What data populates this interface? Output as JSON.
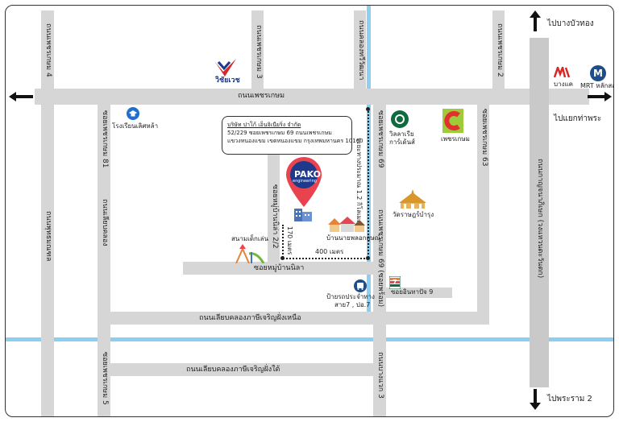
{
  "roads": {
    "petchkasem": "ถนนเพชรเกษม",
    "soi_petchkasem_4": "ถนนเพชรเกษม 4",
    "soi_petchkasem_3": "ถนนเพชรเกษม 3",
    "khlong_thawi_watthana": "ถนนคลองทวีวัฒนา",
    "soi_petchkasem_2": "ถนนเพชรเกษม 2",
    "soi_petchkasem_69_top": "ซอยเพชรเกษม 69",
    "soi_petchkasem_63": "ซอยเพชรเกษม 63",
    "soi_petchkasem_81": "ซอยเพชรเกษม 81",
    "soi_mu_ban_nila_2_2": "ซอยหมู่บ้านนิล่า 2/2",
    "left_road": "ถนนพุทธมณฑล",
    "right_road": "ถนนกาญจนาภิเษก (วงแหวนตะวันตก)",
    "soi_petchkasem_69_lower": "ถนนเพชรเกษม 69 (ซอยพร้อม)",
    "soi_mu_ban_nila": "ซอยหมู่บ้านนิลา",
    "soi_inthanon_9": "ซอยอินทาปัจ 9",
    "canal_north": "ถนนเลียบคลองภาษีเจริญฝั่งเหนือ",
    "canal_south": "ถนนเลียบคลองภาษีเจริญฝั่งใต้",
    "left_lower_v": "ซอยเพชรเกษม 5",
    "left_mid_v": "ถนนเลียบคลอง",
    "mid_lower_v": "ถนนบางแวก 3"
  },
  "directions": {
    "north": "ไปบางบัวทอง",
    "east": "ไปแยกท่าพระ",
    "south": "ไปพระราม 2"
  },
  "distances": {
    "route_1_2km": "ระยะทางประมาณ 1.2 กิโลเมตร",
    "d400": "400 เมตร",
    "d170": "170 เมตร"
  },
  "company": {
    "name": "บริษัท ปาโก้ เอ็นจิเนียริ่ง จำกัด",
    "address1": "52/229 ซอยเพชรเกษม 69 ถนนเพชรเกษม",
    "address2": "แขวงหนองแขม เขตหนองแขม กรุงเทพมหานคร 10160",
    "logo_line1": "PAKO",
    "logo_line2": "engineering"
  },
  "landmarks": {
    "school": "โรงเรียนเลิศหล้า",
    "wittayawet": "วิชัยเวช",
    "makro": "บางแค",
    "mrt": "MRT หลักสอง",
    "mrt_letter": "M",
    "starbucks_line1": "วิลลาเรีย",
    "starbucks_line2": "การ์เด้นส์",
    "big_c": "เพชรเกษม",
    "temple": "วัดราษฎร์บำรุง",
    "village": "บ้านนายพลอกฤษณ์",
    "playground": "สนามเด็กเล่น",
    "bus_stop_line1": "ป้ายรถประจำทาง",
    "bus_stop_line2": "สาย7 , ปอ.7",
    "seven_eleven": "7"
  },
  "colors": {
    "road": "#d6d6d6",
    "canal": "#8dcff0",
    "pin": "#e8434f",
    "pako_blue": "#1f3a8a"
  }
}
